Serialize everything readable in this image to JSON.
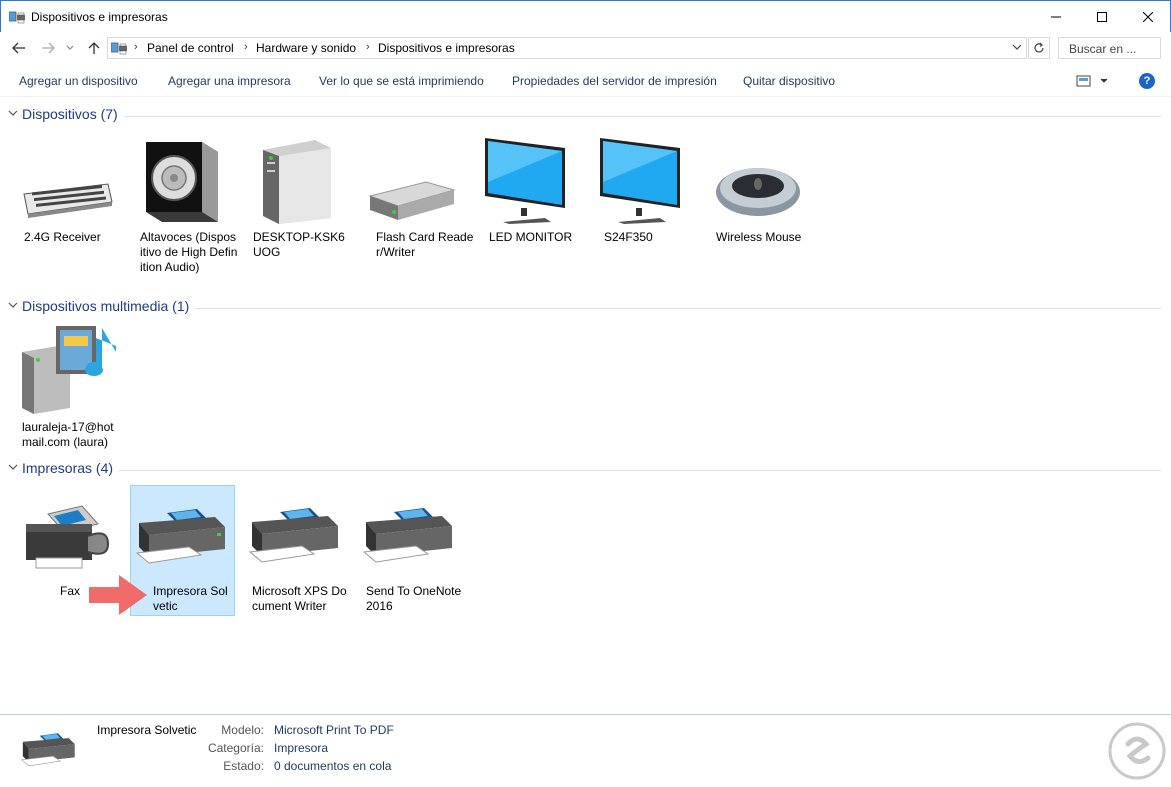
{
  "window": {
    "title": "Dispositivos e impresoras"
  },
  "breadcrumb": [
    "Panel de control",
    "Hardware y sonido",
    "Dispositivos e impresoras"
  ],
  "search": {
    "placeholder": "Buscar en ..."
  },
  "commands": [
    "Agregar un dispositivo",
    "Agregar una impresora",
    "Ver lo que se está imprimiendo",
    "Propiedades del servidor de impresión",
    "Quitar dispositivo"
  ],
  "help_label": "?",
  "groups": {
    "devices": {
      "title": "Dispositivos (7)",
      "items": [
        {
          "label": "2.4G Receiver",
          "icon": "keyboard-icon"
        },
        {
          "label": "Altavoces (Dispositivo de High Definition Audio)",
          "icon": "speaker-icon"
        },
        {
          "label": "DESKTOP-KSK6UOG",
          "icon": "computer-tower-icon"
        },
        {
          "label": "Flash Card Reader/Writer",
          "icon": "card-reader-icon"
        },
        {
          "label": "LED MONITOR",
          "icon": "monitor-icon"
        },
        {
          "label": "S24F350",
          "icon": "monitor-icon"
        },
        {
          "label": "Wireless Mouse",
          "icon": "mouse-icon"
        }
      ]
    },
    "multimedia": {
      "title": "Dispositivos multimedia (1)",
      "items": [
        {
          "label": "lauraleja-17@hotmail.com (laura)",
          "icon": "media-server-icon"
        }
      ]
    },
    "printers": {
      "title": "Impresoras (4)",
      "items": [
        {
          "label": "Fax",
          "icon": "fax-icon"
        },
        {
          "label": "Impresora Solvetic",
          "icon": "printer-icon",
          "selected": true
        },
        {
          "label": "Microsoft XPS Document Writer",
          "icon": "printer-icon"
        },
        {
          "label": "Send To OneNote 2016",
          "icon": "printer-icon"
        }
      ]
    }
  },
  "details": {
    "name": "Impresora Solvetic",
    "rows": [
      {
        "key": "Modelo:",
        "value": "Microsoft Print To PDF"
      },
      {
        "key": "Categoría:",
        "value": "Impresora"
      },
      {
        "key": "Estado:",
        "value": "0 documentos en cola"
      }
    ]
  },
  "colors": {
    "accent": "#1e3a8a",
    "selection": "#cce8ff",
    "arrow": "#f26b6b"
  }
}
